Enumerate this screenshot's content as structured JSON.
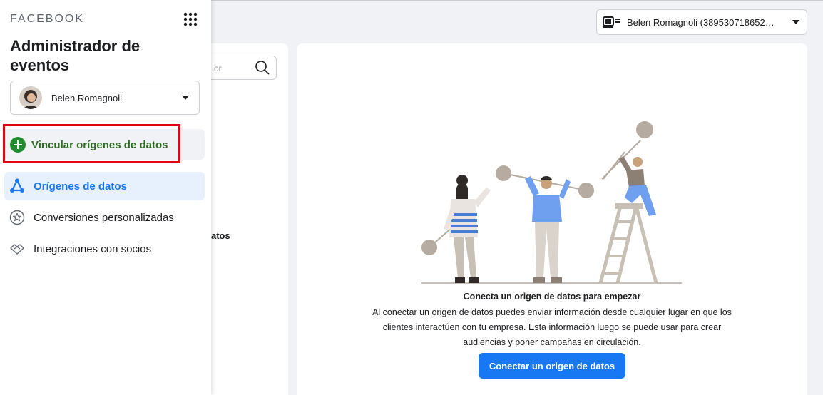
{
  "header": {
    "account_name": "Belen Romagnoli (389530718652…"
  },
  "background_panel": {
    "search_placeholder": "or",
    "text_fragment": "atos"
  },
  "drawer": {
    "brand": "FACEBOOK",
    "title": "Administrador de eventos",
    "user_name": "Belen Romagnoli",
    "link_data_sources_label": "Vincular orígenes de datos",
    "nav_items": [
      {
        "label": "Orígenes de datos",
        "icon": "data-sources-icon",
        "active": true
      },
      {
        "label": "Conversiones personalizadas",
        "icon": "star-icon",
        "active": false
      },
      {
        "label": "Integraciones con socios",
        "icon": "handshake-icon",
        "active": false
      }
    ]
  },
  "main": {
    "empty_title": "Conecta un origen de datos para empezar",
    "empty_description": "Al conectar un origen de datos puedes enviar información desde cualquier lugar en que los clientes interactúen con tu empresa. Esta información luego se puede usar para crear audiencias y poner campañas en circulación.",
    "connect_button": "Conectar un origen de datos"
  },
  "colors": {
    "primary": "#1877f2",
    "link_green": "#2c6e20",
    "highlight_red": "#e4000f",
    "active_bg": "#e7f0fd"
  }
}
